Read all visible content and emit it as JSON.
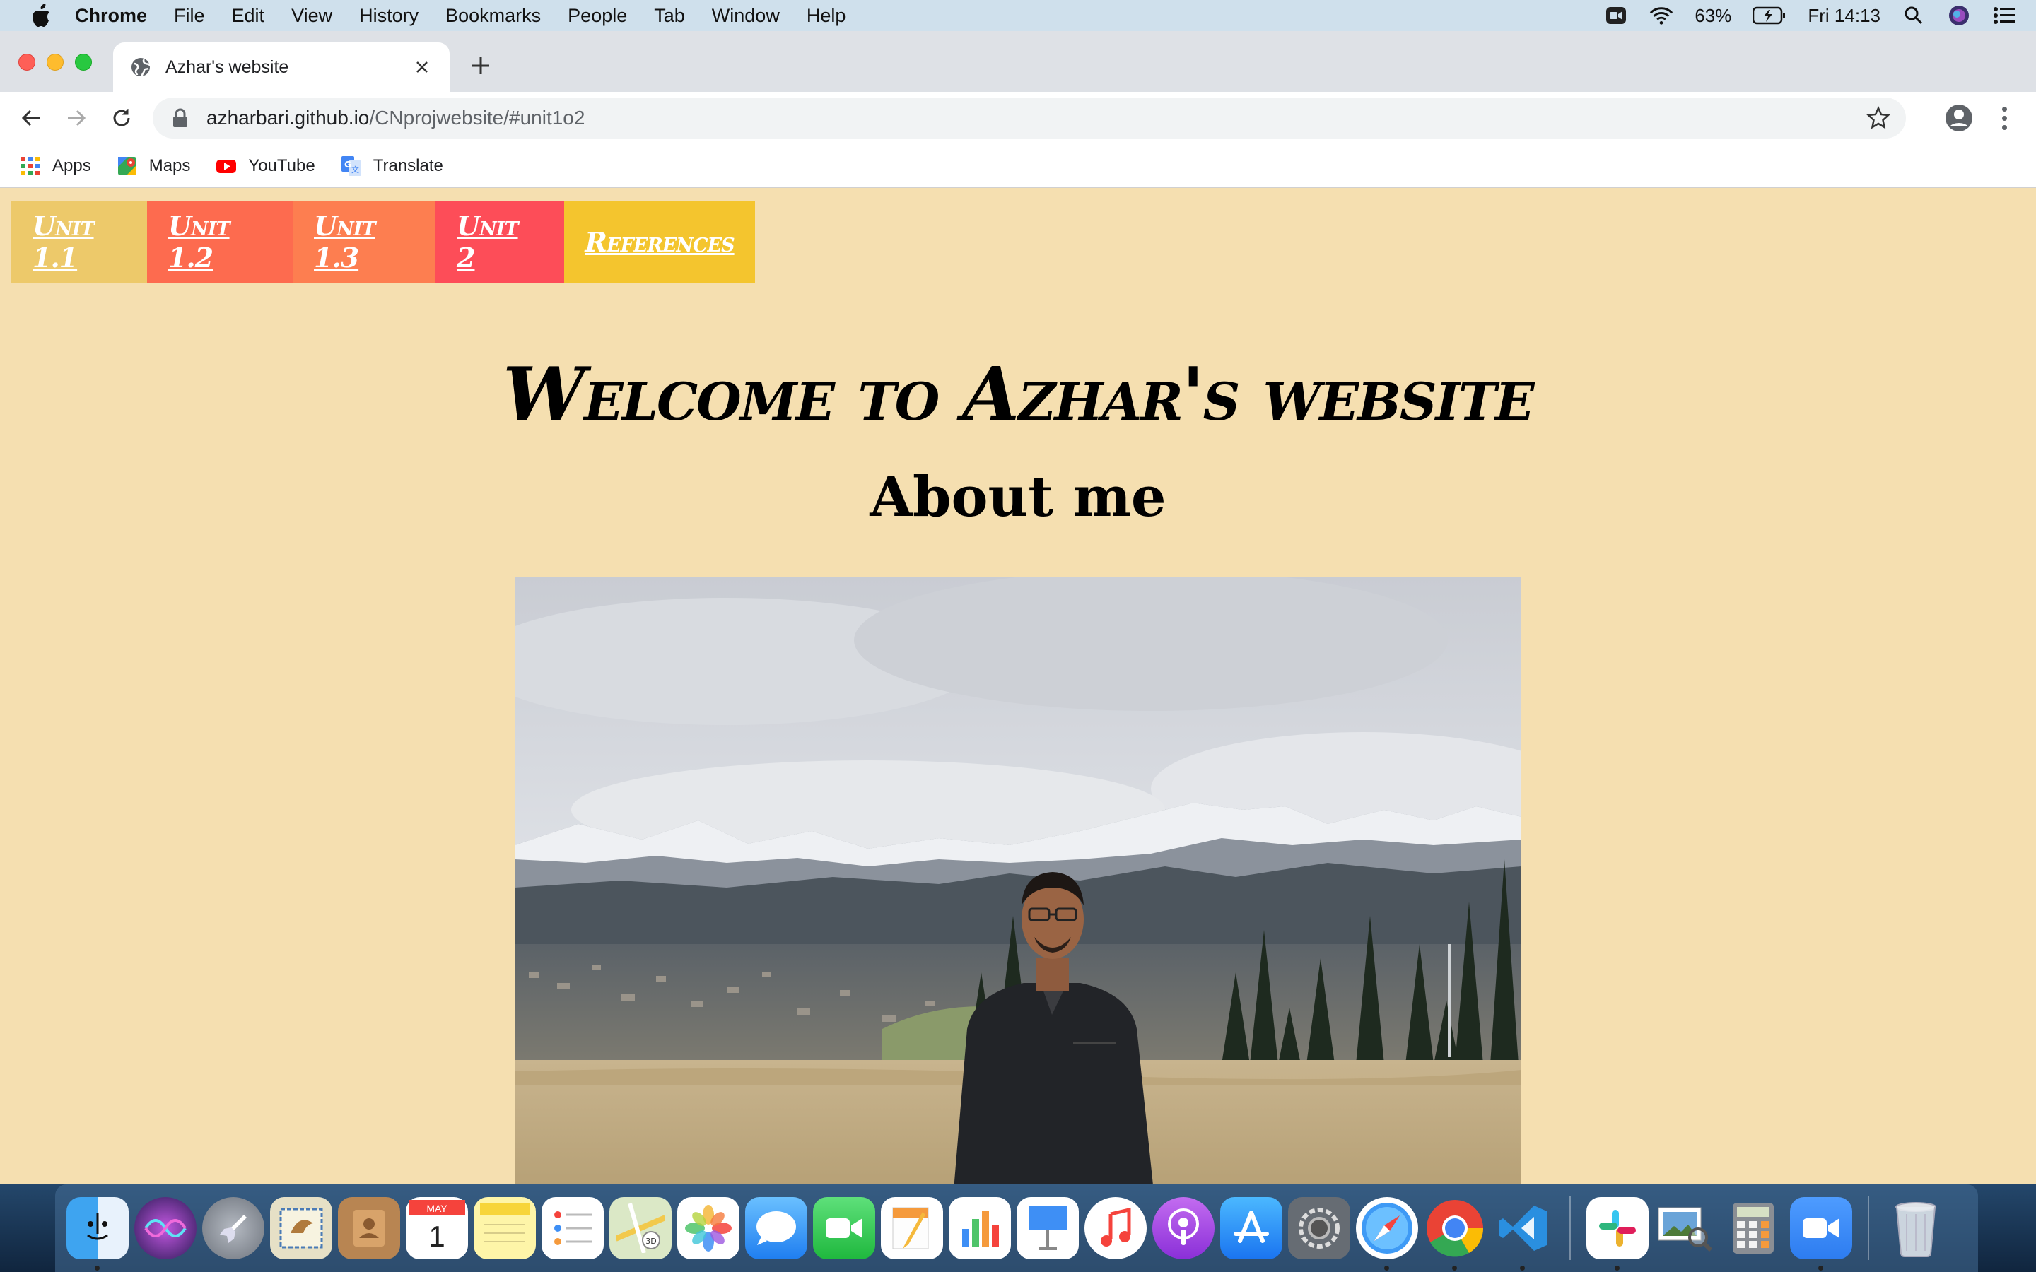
{
  "menubar": {
    "app_name": "Chrome",
    "items": [
      "File",
      "Edit",
      "View",
      "History",
      "Bookmarks",
      "People",
      "Tab",
      "Window",
      "Help"
    ],
    "battery": "63%",
    "clock": "Fri 14:13"
  },
  "browser": {
    "tab_title": "Azhar's website",
    "url_host": "azharbari.github.io",
    "url_path": "/CNprojwebsite/#unit1o2",
    "bookmarks": [
      "Apps",
      "Maps",
      "YouTube",
      "Translate"
    ]
  },
  "page": {
    "nav": [
      "Unit 1.1",
      "Unit 1.2",
      "Unit 1.3",
      "Unit 2",
      "References"
    ],
    "headline": "Welcome to Azhar's website",
    "subheading": "About me",
    "photo_alt": "Azhar standing in front of snowy mountains"
  },
  "dock": {
    "apps": [
      "finder-icon",
      "siri-icon",
      "launchpad-icon",
      "mail-icon",
      "contacts-icon",
      "calendar-icon",
      "notes-icon",
      "reminders-icon",
      "maps-icon",
      "photos-icon",
      "messages-icon",
      "facetime-icon",
      "pages-icon",
      "numbers-icon",
      "keynote-icon",
      "music-icon",
      "podcasts-icon",
      "app-store-icon",
      "system-preferences-icon",
      "safari-icon",
      "chrome-icon",
      "vscode-icon",
      "slack-icon",
      "preview-icon",
      "calculator-icon",
      "zoom-icon",
      "trash-icon"
    ],
    "calendar_month": "MAY",
    "calendar_day": "1"
  }
}
